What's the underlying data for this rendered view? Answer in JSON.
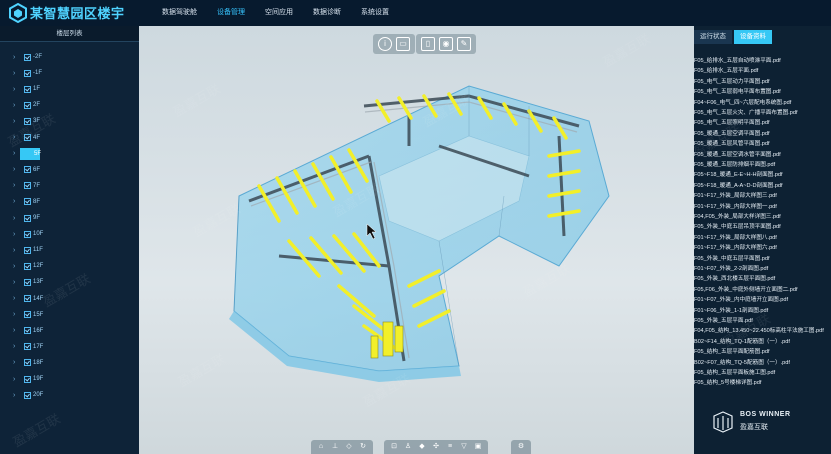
{
  "header": {
    "title": "某智慧园区楼宇",
    "nav": [
      "数据驾驶舱",
      "设备管理",
      "空间应用",
      "数据诊断",
      "系统设置"
    ],
    "active_nav": 1
  },
  "sidebar": {
    "title": "楼层列表",
    "floors": [
      "-2F",
      "-1F",
      "1F",
      "2F",
      "3F",
      "4F",
      "5F",
      "6F",
      "7F",
      "8F",
      "9F",
      "10F",
      "11F",
      "12F",
      "13F",
      "14F",
      "15F",
      "16F",
      "17F",
      "18F",
      "19F",
      "20F"
    ],
    "selected_floor": "5F"
  },
  "viewer": {
    "top_tools_a": [
      "info-icon",
      "ruler-icon"
    ],
    "top_tools_b": [
      "bookmark-icon",
      "camera-icon",
      "pencil-icon"
    ],
    "bottom_tools": [
      "home-icon",
      "measure-icon",
      "area-icon",
      "rotate-icon",
      "section-icon",
      "walk-icon",
      "cube-icon",
      "explode-icon",
      "layers-icon",
      "settings-icon"
    ]
  },
  "right_panel": {
    "tabs": [
      "运行状态",
      "设备资料"
    ],
    "active_tab": 1,
    "documents": [
      "F05_给排水_五层自动喷淋平面.pdf",
      "F05_给排水_五层平面.pdf",
      "F05_电气_五层动力平面图.pdf",
      "F05_电气_五层弱电平面布置图.pdf",
      "F04~F06_电气_四~六层配电系统图.pdf",
      "F05_电气_五层火灾、广播平面布置图.pdf",
      "F05_电气_五层照明平面图.pdf",
      "F05_暖通_五层空调平面图.pdf",
      "F05_暖通_五层风管平面图.pdf",
      "F05_暖通_五层空调水管平面图.pdf",
      "F05_暖通_五层防排烟平面图.pdf",
      "F05~F18_暖通_E-E~H-H剖面图.pdf",
      "F05~F18_暖通_A-A~D-D剖面图.pdf",
      "F01~F17_外装_局部大样图三.pdf",
      "F01~F17_外装_内部大样图一.pdf",
      "F04,F05_外装_局部大样详图三.pdf",
      "F05_外装_中庭五层吊顶平面图.pdf",
      "F01~F17_外装_局部大样图八.pdf",
      "F01~F17_外装_内部大样图六.pdf",
      "F05_外装_中庭五层平面图.pdf",
      "F01~F07_外装_2-2剖面图.pdf",
      "F05_外装_西北楼五层平面图.pdf",
      "F05,F06_外装_中庭外侧墙开立面图二.pdf",
      "F01~F07_外装_内中庭墙开立面图.pdf",
      "F01~F06_外装_1-1剖面图.pdf",
      "F05_外装_五层平面.pdf",
      "F04,F05_结构_13.450~22.450标高柱平法施工图.pdf",
      "B02~F14_结构_TQ-1配筋图（一）.pdf",
      "F05_结构_五层平面配筋图.pdf",
      "B02~F07_结构_TQ-5配筋图（一）.pdf",
      "F05_结构_五层平面板施工图.pdf",
      "F05_结构_5号楼梯详图.pdf"
    ],
    "brand_en": "BOS WINNER",
    "brand_cn": "盈嘉互联"
  },
  "watermark": "盈嘉互联",
  "colors": {
    "accent": "#36c8f5",
    "topbar": "#071a2e",
    "panel": "#0d2133",
    "pipe_yellow": "#f2ef2a"
  }
}
